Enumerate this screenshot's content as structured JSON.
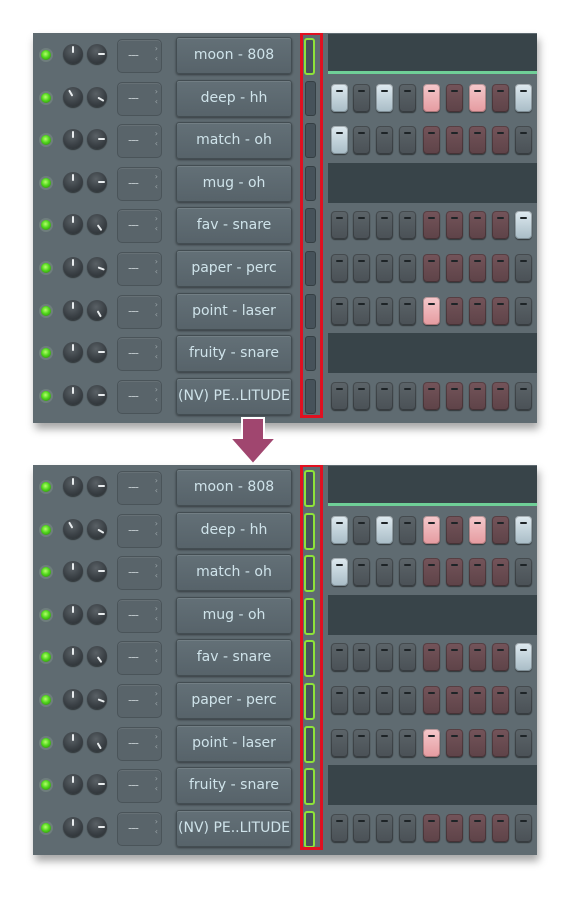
{
  "colors": {
    "panel_bg": "#5f6b71",
    "led_on": "#4fd61c",
    "highlight_frame": "#e01020",
    "selected_outline": "#8ee23a",
    "graph_line": "#6fcf97",
    "arrow": "#a0466f"
  },
  "mixer_track_label": "---",
  "arrow_icon": "down-arrow-icon",
  "panels": [
    {
      "id": "before",
      "channels": [
        {
          "name": "moon - 808",
          "led": true,
          "vol": 0,
          "pan": 90,
          "selected": true,
          "type": "graph"
        },
        {
          "name": "deep - hh",
          "led": true,
          "vol": -30,
          "pan": 120,
          "selected": false,
          "type": "steps",
          "steps": [
            1,
            0,
            1,
            0,
            1,
            0,
            1,
            0,
            1
          ]
        },
        {
          "name": "match - oh",
          "led": true,
          "vol": 0,
          "pan": 90,
          "selected": false,
          "type": "steps",
          "steps": [
            1,
            0,
            0,
            0,
            0,
            0,
            0,
            0,
            0
          ]
        },
        {
          "name": "mug - oh",
          "led": true,
          "vol": 0,
          "pan": 90,
          "selected": false,
          "type": "graph_empty"
        },
        {
          "name": "fav - snare",
          "led": true,
          "vol": 0,
          "pan": 145,
          "selected": false,
          "type": "steps",
          "steps": [
            0,
            0,
            0,
            0,
            0,
            0,
            0,
            0,
            1
          ]
        },
        {
          "name": "paper - perc",
          "led": true,
          "vol": 0,
          "pan": 110,
          "selected": false,
          "type": "steps",
          "steps": [
            0,
            0,
            0,
            0,
            0,
            0,
            0,
            0,
            0
          ]
        },
        {
          "name": "point - laser",
          "led": true,
          "vol": 0,
          "pan": 150,
          "selected": false,
          "type": "steps",
          "steps": [
            0,
            0,
            0,
            0,
            1,
            0,
            0,
            0,
            0
          ]
        },
        {
          "name": "fruity - snare",
          "led": true,
          "vol": 0,
          "pan": 90,
          "selected": false,
          "type": "graph_empty"
        },
        {
          "name": "(NV) PE..LITUDE",
          "led": true,
          "vol": 0,
          "pan": 90,
          "selected": false,
          "type": "steps",
          "steps": [
            0,
            0,
            0,
            0,
            0,
            0,
            0,
            0,
            0
          ]
        }
      ]
    },
    {
      "id": "after",
      "channels": [
        {
          "name": "moon - 808",
          "led": true,
          "vol": 0,
          "pan": 90,
          "selected": true,
          "type": "graph"
        },
        {
          "name": "deep - hh",
          "led": true,
          "vol": -30,
          "pan": 120,
          "selected": true,
          "type": "steps",
          "steps": [
            1,
            0,
            1,
            0,
            1,
            0,
            1,
            0,
            1
          ]
        },
        {
          "name": "match - oh",
          "led": true,
          "vol": 0,
          "pan": 90,
          "selected": true,
          "type": "steps",
          "steps": [
            1,
            0,
            0,
            0,
            0,
            0,
            0,
            0,
            0
          ]
        },
        {
          "name": "mug - oh",
          "led": true,
          "vol": 0,
          "pan": 90,
          "selected": true,
          "type": "graph_empty"
        },
        {
          "name": "fav - snare",
          "led": true,
          "vol": 0,
          "pan": 145,
          "selected": true,
          "type": "steps",
          "steps": [
            0,
            0,
            0,
            0,
            0,
            0,
            0,
            0,
            1
          ]
        },
        {
          "name": "paper - perc",
          "led": true,
          "vol": 0,
          "pan": 110,
          "selected": true,
          "type": "steps",
          "steps": [
            0,
            0,
            0,
            0,
            0,
            0,
            0,
            0,
            0
          ]
        },
        {
          "name": "point - laser",
          "led": true,
          "vol": 0,
          "pan": 150,
          "selected": true,
          "type": "steps",
          "steps": [
            0,
            0,
            0,
            0,
            1,
            0,
            0,
            0,
            0
          ]
        },
        {
          "name": "fruity - snare",
          "led": true,
          "vol": 0,
          "pan": 90,
          "selected": true,
          "type": "graph_empty"
        },
        {
          "name": "(NV) PE..LITUDE",
          "led": true,
          "vol": 0,
          "pan": 90,
          "selected": true,
          "type": "steps",
          "steps": [
            0,
            0,
            0,
            0,
            0,
            0,
            0,
            0,
            0
          ]
        }
      ]
    }
  ]
}
